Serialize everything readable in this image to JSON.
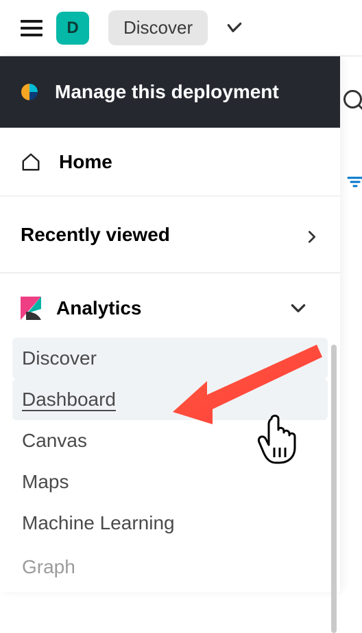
{
  "topbar": {
    "logo_letter": "D",
    "discover_label": "Discover"
  },
  "panel": {
    "manage_label": "Manage this deployment",
    "home_label": "Home",
    "recent_label": "Recently viewed",
    "analytics_label": "Analytics",
    "items": [
      {
        "label": "Discover"
      },
      {
        "label": "Dashboard"
      },
      {
        "label": "Canvas"
      },
      {
        "label": "Maps"
      },
      {
        "label": "Machine Learning"
      },
      {
        "label": "Graph"
      }
    ]
  }
}
